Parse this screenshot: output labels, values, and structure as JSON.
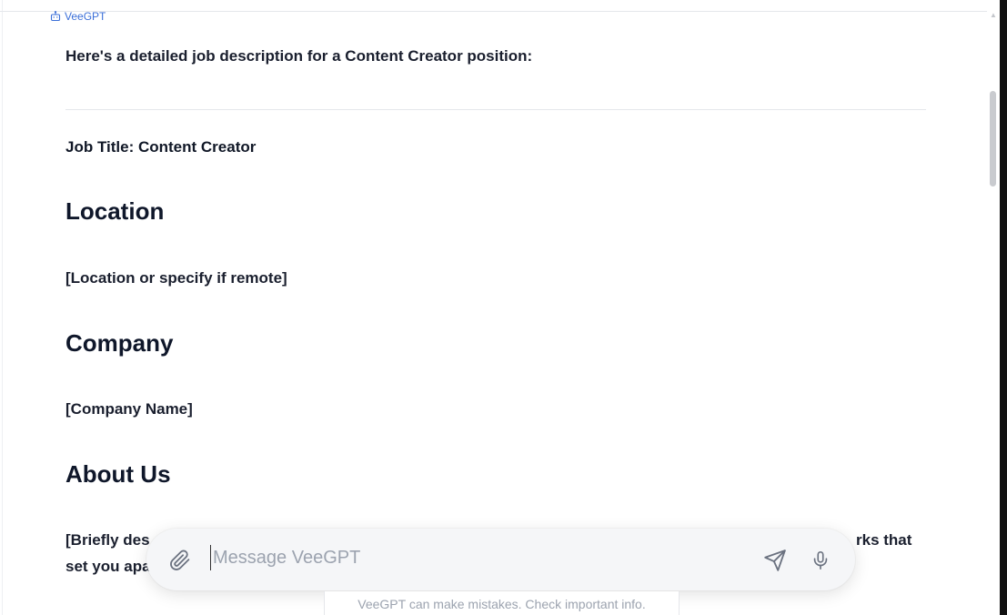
{
  "sender": {
    "name": "VeeGPT",
    "icon": "robot-icon"
  },
  "message": {
    "intro": "Here's a detailed job description for a Content Creator position:",
    "job_title": "Job Title: Content Creator",
    "sections": [
      {
        "heading": "Location",
        "body": "[Location or specify if remote]"
      },
      {
        "heading": "Company",
        "body": "[Company Name]"
      },
      {
        "heading": "About Us",
        "body": "[Briefly des",
        "body_line2": "set you apa",
        "body_trailing": "rks that"
      }
    ]
  },
  "composer": {
    "placeholder": "Message VeeGPT",
    "attach_icon": "paperclip-icon",
    "send_icon": "send-icon",
    "mic_icon": "microphone-icon"
  },
  "footer": {
    "disclaimer": "VeeGPT can make mistakes. Check important info."
  },
  "colors": {
    "accent": "#3b6fd8",
    "text": "#1a1f2e",
    "muted": "#9ca3af"
  }
}
